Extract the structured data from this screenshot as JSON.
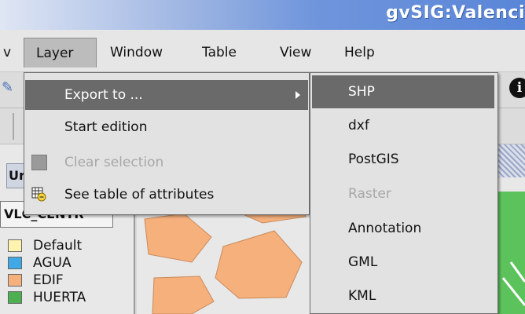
{
  "window": {
    "title": "gvSIG:Valenci"
  },
  "menubar": {
    "partial_item": "v",
    "items": [
      {
        "label": "Layer",
        "active": true
      },
      {
        "label": "Window"
      },
      {
        "label": "Table"
      },
      {
        "label": "View"
      },
      {
        "label": "Help"
      }
    ]
  },
  "layer_menu": {
    "items": [
      {
        "label": "Export to ...",
        "highlighted": true,
        "has_submenu": true
      },
      {
        "label": "Start edition"
      },
      {
        "label": "Clear selection",
        "disabled": true,
        "icon": "selection-icon"
      },
      {
        "label": "See table of attributes",
        "icon": "table-icon"
      }
    ]
  },
  "export_submenu": {
    "items": [
      {
        "label": "SHP",
        "highlighted": true
      },
      {
        "label": "dxf"
      },
      {
        "label": "PostGIS"
      },
      {
        "label": "Raster",
        "disabled": true
      },
      {
        "label": "Annotation"
      },
      {
        "label": "GML"
      },
      {
        "label": "KML"
      }
    ]
  },
  "toc": {
    "header_partial": "Ur",
    "layer_name_partial": "VLC_CENTR",
    "legend": [
      {
        "label": "Default",
        "color": "#fff3b0"
      },
      {
        "label": "AGUA",
        "color": "#3fa9e8"
      },
      {
        "label": "EDIF",
        "color": "#f5b07c"
      },
      {
        "label": "HUERTA",
        "color": "#4caf50"
      }
    ]
  },
  "colors": {
    "highlight": "#6a6a6a",
    "map_block": "#f5b07c",
    "map_street": "#ffffff",
    "map_green": "#5cc35c"
  }
}
